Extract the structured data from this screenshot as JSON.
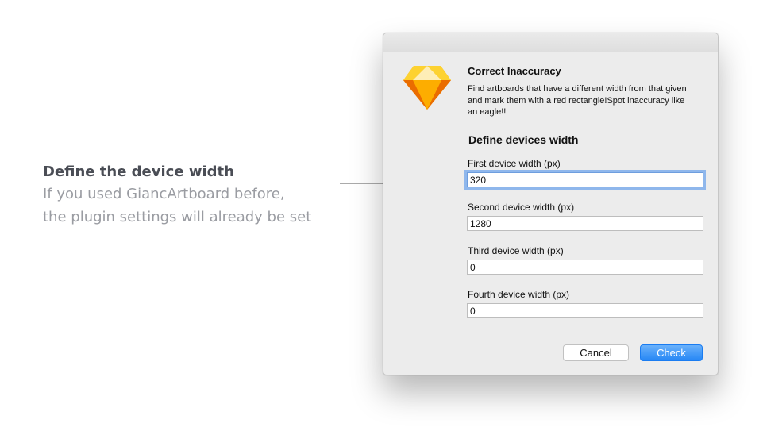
{
  "caption": {
    "title": "Define the device width",
    "line1": "If you used GiancArtboard before,",
    "line2": "the plugin settings will already be set"
  },
  "dialog": {
    "plugin_title": "Correct Inaccuracy",
    "plugin_description": "Find artboards that have a different width from that given and mark them with a red rectangle!Spot inaccuracy like an eagle!!",
    "section_heading": "Define devices width",
    "fields": [
      {
        "label": "First device width (px)",
        "value": "320"
      },
      {
        "label": "Second device width (px)",
        "value": "1280"
      },
      {
        "label": "Third device width (px)",
        "value": "0"
      },
      {
        "label": "Fourth device width (px)",
        "value": "0"
      }
    ],
    "cancel_label": "Cancel",
    "check_label": "Check",
    "logo_icon": "sketch-diamond-icon",
    "accent_color": "#2687f5"
  }
}
